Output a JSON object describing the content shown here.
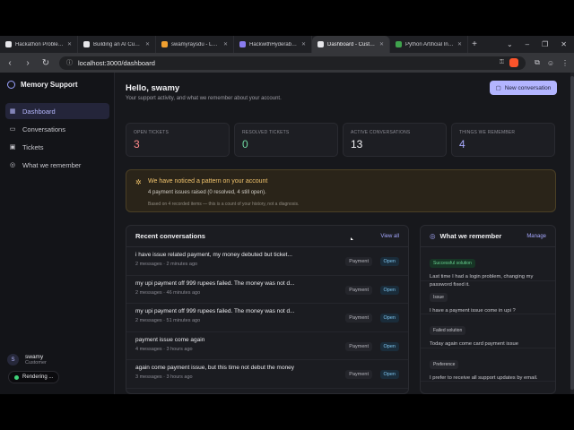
{
  "browser": {
    "tabs": [
      {
        "title": "Hackathon Problem St",
        "fav_color": "#e6e6ea"
      },
      {
        "title": "Building an AI Custome",
        "fav_color": "#e6e6ea"
      },
      {
        "title": "swamyraysdu - LeetCo",
        "fav_color": "#f0a030"
      },
      {
        "title": "HackwithHyderabad H",
        "fav_color": "#8a7cf0"
      },
      {
        "title": "Dashboard - Custom",
        "fav_color": "#e6e6ea"
      },
      {
        "title": "Python Artificial Intellig",
        "fav_color": "#3fa34d"
      }
    ],
    "url": "localhost:3000/dashboard"
  },
  "sidebar": {
    "brand": "Memory Support",
    "items": [
      {
        "label": "Dashboard",
        "icon": "grid-icon"
      },
      {
        "label": "Conversations",
        "icon": "chat-icon"
      },
      {
        "label": "Tickets",
        "icon": "ticket-icon"
      },
      {
        "label": "What we remember",
        "icon": "brain-icon"
      }
    ],
    "user": {
      "initial": "S",
      "name": "swamy",
      "role": "Customer"
    },
    "rendering": "Rendering ..."
  },
  "header": {
    "greeting": "Hello, swamy",
    "subtitle": "Your support activity, and what we remember about your account.",
    "new_conversation": "New conversation"
  },
  "stats": [
    {
      "label": "OPEN TICKETS",
      "value": "3",
      "color": "#ff8a8a"
    },
    {
      "label": "RESOLVED TICKETS",
      "value": "0",
      "color": "#6fd6a0"
    },
    {
      "label": "ACTIVE CONVERSATIONS",
      "value": "13",
      "color": "#f3f3f6"
    },
    {
      "label": "THINGS WE REMEMBER",
      "value": "4",
      "color": "#a9abff"
    }
  ],
  "notice": {
    "title": "We have noticed a pattern on your account",
    "text": "4 payment issues raised (0 resolved, 4 still open).",
    "footnote": "Based on 4 recorded items — this is a count of your history, not a diagnosis."
  },
  "recent": {
    "title": "Recent conversations",
    "view_all": "View all",
    "items": [
      {
        "title": "i have issue related payment, my money debuted but ticket...",
        "meta": "2 messages · 2 minutes ago",
        "category": "Payment",
        "status": "Open"
      },
      {
        "title": "my upi payment off 999 rupees failed. The money was not d...",
        "meta": "2 messages · 46 minutes ago",
        "category": "Payment",
        "status": "Open"
      },
      {
        "title": "my upi payment off 999 rupees failed. The money was not d...",
        "meta": "2 messages · 51 minutes ago",
        "category": "Payment",
        "status": "Open"
      },
      {
        "title": "payment issue come again",
        "meta": "4 messages · 3 hours ago",
        "category": "Payment",
        "status": "Open"
      },
      {
        "title": "again come payment issue, but this time not debut the money",
        "meta": "3 messages · 3 hours ago",
        "category": "Payment",
        "status": "Open"
      }
    ]
  },
  "memory": {
    "title": "What we remember",
    "manage": "Manage",
    "items": [
      {
        "tag": "Successful solution",
        "text": "Last time I had a login problem, changing my password fixed it."
      },
      {
        "tag": "Issue",
        "text": "I have a payment issue come in upi ?"
      },
      {
        "tag": "Failed solution",
        "text": "Today again come card payment issue"
      },
      {
        "tag": "Preference",
        "text": "I prefer to receive all support updates by email."
      }
    ]
  }
}
